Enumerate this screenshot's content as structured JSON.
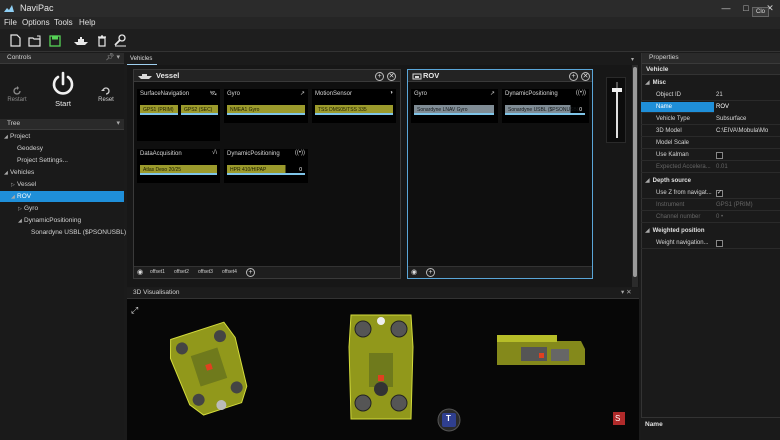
{
  "window": {
    "title": "NaviPac",
    "minimize": "—",
    "maximize": "□",
    "close": "✕",
    "close_tooltip": "Clo"
  },
  "menu": [
    "File",
    "Options",
    "Tools",
    "Help"
  ],
  "toolbar": {
    "icons": [
      "new-file-icon",
      "open-folder-icon",
      "save-icon",
      "vessel-icon",
      "delete-icon",
      "wrench-icon"
    ]
  },
  "controls": {
    "title": "Controls",
    "restart": "Restart",
    "start": "Start",
    "reset": "Reset"
  },
  "tree": {
    "title": "Tree",
    "items": [
      {
        "label": "Project",
        "indent": 0,
        "arrow": "◢"
      },
      {
        "label": "Geodesy",
        "indent": 1,
        "arrow": ""
      },
      {
        "label": "Project Settings...",
        "indent": 1,
        "arrow": ""
      },
      {
        "label": "Vehicles",
        "indent": 0,
        "arrow": "◢"
      },
      {
        "label": "Vessel",
        "indent": 1,
        "arrow": "▷"
      },
      {
        "label": "ROV",
        "indent": 1,
        "arrow": "◢",
        "selected": true
      },
      {
        "label": "Gyro",
        "indent": 2,
        "arrow": "▷"
      },
      {
        "label": "DynamicPositioning",
        "indent": 2,
        "arrow": "◢"
      },
      {
        "label": "Sonardyne USBL ($PSONUSBL)",
        "indent": 3,
        "arrow": ""
      }
    ]
  },
  "vehicles_tab": "Vehicles",
  "vessel_card": {
    "title": "Vessel",
    "sensors": [
      {
        "title": "SurfaceNavigation",
        "chips": [
          "GPS1 (PRIM)",
          "GPS2 (SEC)"
        ]
      },
      {
        "title": "Gyro",
        "chips": [
          "NMEA1 Gyro"
        ]
      },
      {
        "title": "MotionSensor",
        "chips": [
          "TSS DMS05/TSS 335"
        ]
      },
      {
        "title": "DataAcquisition",
        "chips": [
          "Atlas Deso 20/25"
        ]
      },
      {
        "title": "DynamicPositioning",
        "chips": [
          "HPR 410/HIPAP"
        ],
        "value": "0"
      }
    ],
    "offsets": [
      "offset1",
      "offset2",
      "offset3",
      "offset4"
    ]
  },
  "rov_card": {
    "title": "ROV",
    "sensors": [
      {
        "title": "Gyro",
        "chips": [
          "Sonardyne LNAV Gyro"
        ]
      },
      {
        "title": "DynamicPositioning",
        "chips": [
          "Sonardyne USBL ($PSONUSBL)"
        ],
        "value": "0"
      }
    ]
  },
  "viz": {
    "title": "3D Visualisation",
    "compass_label": "T",
    "corner_label": "S"
  },
  "properties": {
    "title": "Properties",
    "header": "Vehicle",
    "misc": "Misc",
    "rows": [
      {
        "key": "Object ID",
        "value": "21"
      },
      {
        "key": "Name",
        "value": "ROV",
        "selected": true
      },
      {
        "key": "Vehicle Type",
        "value": "Subsurface"
      },
      {
        "key": "3D Model",
        "value": "C:\\EIVA\\Mobula\\Mo"
      },
      {
        "key": "Model Scale",
        "value": ""
      },
      {
        "key": "Use Kalman",
        "value": "",
        "checkbox": false
      },
      {
        "key": "Expected Accelera...",
        "value": "0.01",
        "dim": true
      }
    ],
    "depth_source": "Depth source",
    "depth_rows": [
      {
        "key": "Use Z from navigat...",
        "value": "",
        "checkbox": true
      },
      {
        "key": "Instrument",
        "value": "GPS1 (PRIM)",
        "dim": true
      },
      {
        "key": "Channel number",
        "value": "0 •",
        "dim": true
      }
    ],
    "weighted_position": "Weighted position",
    "weighted_rows": [
      {
        "key": "Weight navigation...",
        "value": "",
        "checkbox": false
      }
    ],
    "footer": "Name"
  },
  "colors": {
    "accent": "#1f8fd9",
    "chip_olive": "#9b9a2c",
    "chip_grey": "#7f8c95",
    "model_yellow": "#c8d22a"
  }
}
